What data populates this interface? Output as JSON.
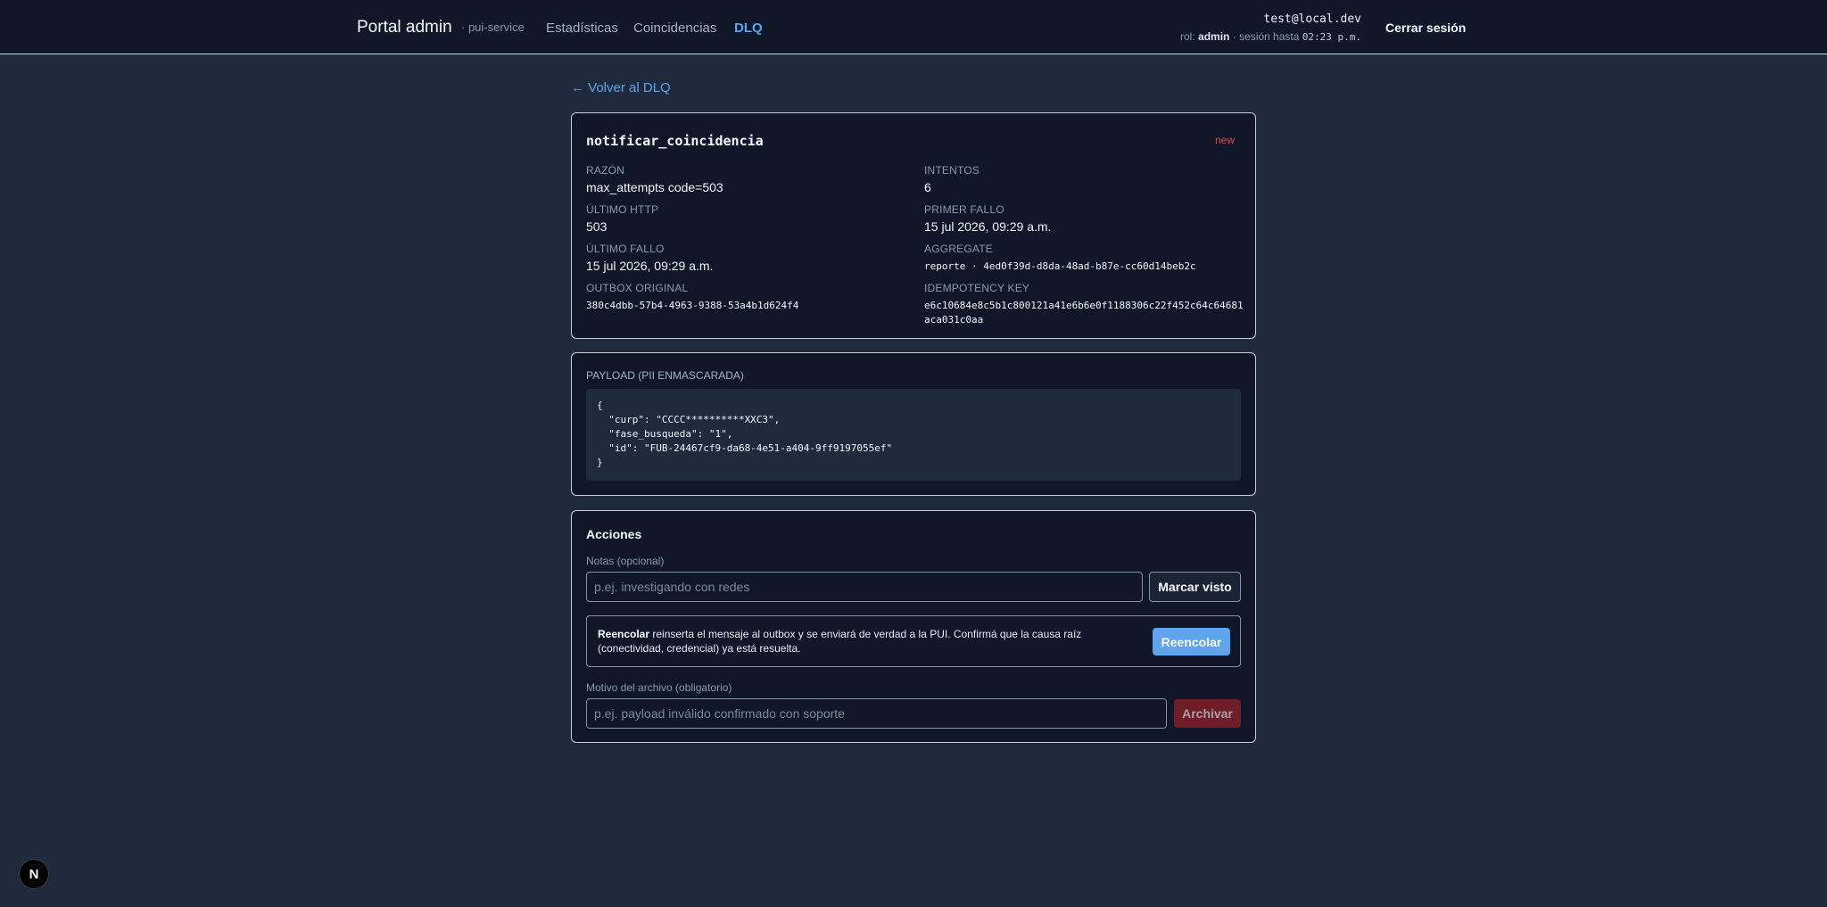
{
  "header": {
    "brand": "Portal admin",
    "brand_sub": "· pui-service",
    "nav": [
      {
        "label": "Estadísticas",
        "active": false
      },
      {
        "label": "Coincidencias",
        "active": false
      },
      {
        "label": "DLQ",
        "active": true
      }
    ],
    "user": {
      "email": "test@local.dev",
      "role_label": "rol:",
      "role": "admin",
      "session_label": "· sesión hasta",
      "session_until": "02:23 p.m."
    },
    "logout_label": "Cerrar sesión"
  },
  "back_link": "← Volver al DLQ",
  "detail": {
    "job": "notificar_coincidencia",
    "status": "new",
    "fields": {
      "razon": {
        "label": "Razón",
        "value": "max_attempts code=503"
      },
      "intentos": {
        "label": "Intentos",
        "value": "6"
      },
      "ultimo_http": {
        "label": "Último HTTP",
        "value": "503"
      },
      "primer_fallo": {
        "label": "Primer fallo",
        "value": "15 jul 2026, 09:29 a.m."
      },
      "ultimo_fallo": {
        "label": "Último fallo",
        "value": "15 jul 2026, 09:29 a.m."
      },
      "aggregate": {
        "label": "Aggregate",
        "value": "reporte · 4ed0f39d-d8da-48ad-b87e-cc60d14beb2c"
      },
      "outbox_original": {
        "label": "Outbox original",
        "value": "380c4dbb-57b4-4963-9388-53a4b1d624f4"
      },
      "idempotency_key": {
        "label": "Idempotency key",
        "value": "e6c10684e8c5b1c800121a41e6b6e0f1188306c22f452c64c64681aca031c0aa"
      }
    }
  },
  "payload": {
    "label": "Payload (PII enmascarada)",
    "content": "{\n  \"curp\": \"CCCC**********XXC3\",\n  \"fase_busqueda\": \"1\",\n  \"id\": \"FUB-24467cf9-da68-4e51-a404-9ff9197055ef\"\n}"
  },
  "actions": {
    "title": "Acciones",
    "notes_label": "Notas (opcional)",
    "notes_placeholder": "p.ej. investigando con redes",
    "mark_seen_label": "Marcar visto",
    "requeue_bold": "Reencolar",
    "requeue_text": " reinserta el mensaje al outbox y se enviará de verdad a la PUI. Confirmá que la causa raíz (conectividad, credencial) ya está resuelta.",
    "requeue_button": "Reencolar",
    "archive_label": "Motivo del archivo (obligatorio)",
    "archive_placeholder": "p.ej. payload inválido confirmado con soporte",
    "archive_button": "Archivar"
  },
  "footer": {
    "dev_badge": "N"
  }
}
